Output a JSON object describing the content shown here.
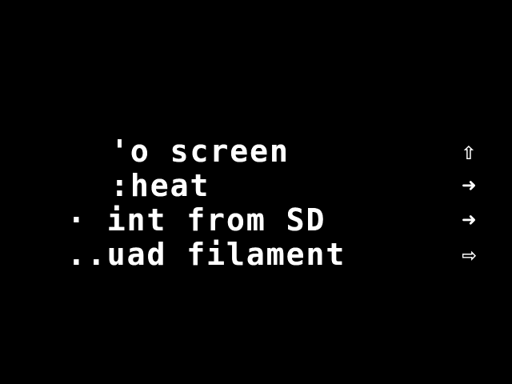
{
  "screen": {
    "background_color": "#000000",
    "text_color": "#ffffff"
  },
  "menu": {
    "items": [
      {
        "label": "'o screen",
        "icon": "up-arrow-icon",
        "glyph": "⇧"
      },
      {
        "label": ":heat",
        "icon": "right-arrow-icon",
        "glyph": "➜"
      },
      {
        "label": "· int from SD",
        "icon": "right-arrow-icon",
        "glyph": "➜"
      },
      {
        "label": "..uad filament",
        "icon": "right-arrow-icon",
        "glyph": "⇨"
      }
    ]
  }
}
